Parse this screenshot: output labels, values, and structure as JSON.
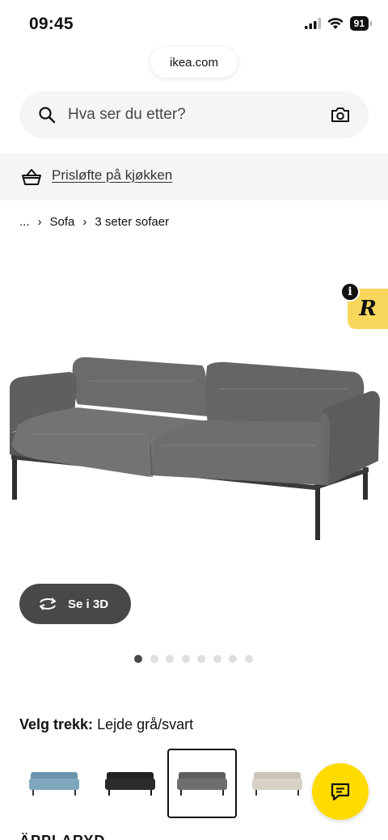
{
  "status_bar": {
    "time": "09:45",
    "battery": "91"
  },
  "browser": {
    "url": "ikea.com"
  },
  "search": {
    "placeholder": "Hva ser du etter?"
  },
  "promo": {
    "link_text": "Prisløfte på kjøkken"
  },
  "breadcrumb": {
    "ellipsis": "...",
    "items": [
      "Sofa",
      "3 seter sofaer"
    ]
  },
  "badge": {
    "letter": "R",
    "info": "i"
  },
  "view3d": {
    "label": "Se i 3D"
  },
  "carousel": {
    "total": 8,
    "active_index": 0
  },
  "cover": {
    "label": "Velg trekk:",
    "value": "Lejde grå/svart"
  },
  "swatches": [
    {
      "name": "Lejde blå",
      "color": "#7fa8bf",
      "selected": false
    },
    {
      "name": "Lejde svart",
      "color": "#2b2b2b",
      "selected": false
    },
    {
      "name": "Lejde grå/svart",
      "color": "#6e6e6e",
      "selected": true
    },
    {
      "name": "Lejde beige",
      "color": "#d8d2c6",
      "selected": false
    }
  ],
  "next_heading": "ÄPPLARYD",
  "colors": {
    "accent_yellow": "#ffdb00",
    "dark_button": "#484848",
    "panel_grey": "#f5f5f5"
  }
}
